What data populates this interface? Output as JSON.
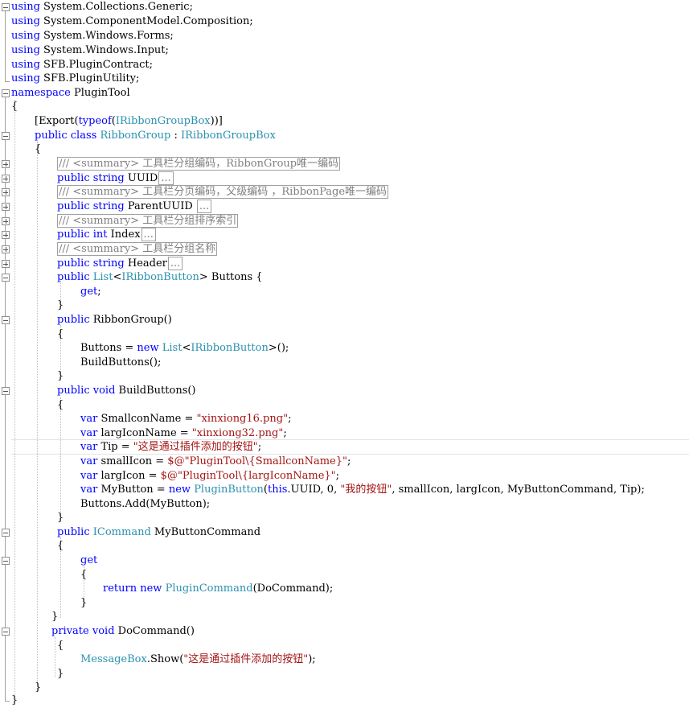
{
  "code": {
    "using1": "using",
    "ns1": "System.Collections.Generic;",
    "using2": "using",
    "ns2": "System.ComponentModel.Composition;",
    "using3": "using",
    "ns3": "System.Windows.Forms;",
    "using4": "using",
    "ns4": "System.Windows.Input;",
    "using5": "using",
    "ns5": "SFB.PluginContract;",
    "using6": "using",
    "ns6": "SFB.PluginUtility;",
    "namespace_kw": "namespace",
    "namespace_name": "PluginTool",
    "brace_open": "{",
    "brace_close": "}",
    "export_open": "[Export(",
    "typeof_kw": "typeof",
    "paren_open": "(",
    "iface": "IRibbonGroupBox",
    "export_close": "))]",
    "public_kw": "public",
    "class_kw": "class",
    "class_name": "RibbonGroup",
    "colon": " : ",
    "comment_uuid": "/// <summary> 工具栏分组编码，RibbonGroup唯一编码",
    "string_kw": "string",
    "prop_uuid": "UUID",
    "ellipsis": "...",
    "comment_parent": "/// <summary> 工具栏分页编码，父级编码 ，RibbonPage唯一编码",
    "prop_parent": "ParentUUID ",
    "comment_index": "/// <summary> 工具栏分组排序索引",
    "int_kw": "int",
    "prop_index": "Index",
    "comment_header": "/// <summary> 工具栏分组名称",
    "prop_header": "Header",
    "list_type": "List",
    "lt": "<",
    "button_iface": "IRibbonButton",
    "gt": ">",
    "prop_buttons": " Buttons {",
    "get_kw": "get",
    "semicolon": ";",
    "ctor": " RibbonGroup()",
    "buttons_assign": "Buttons = ",
    "new_kw": "new",
    "list_ctor_end": "();",
    "build_call": "BuildButtons();",
    "void_kw": "void",
    "build_method": " BuildButtons()",
    "var_kw": "var",
    "small_name_decl": " SmallconName = ",
    "small_name_val": "\"xinxiong16.png\"",
    "larg_name_decl": " largIconName = ",
    "larg_name_val": "\"xinxiong32.png\"",
    "tip_decl": " Tip = ",
    "tip_val": "\"这是通过插件添加的按钮\"",
    "small_icon_decl": " smallIcon = ",
    "small_icon_val": "$@\"PluginTool\\{SmallconName}\"",
    "larg_icon_decl": " largIcon = ",
    "larg_icon_val": "$@\"PluginTool\\{largIconName}\"",
    "mybutton_decl": " MyButton = ",
    "plugin_button": "PluginButton",
    "this_kw": "this",
    "mybutton_args1": ".UUID, 0, ",
    "mybutton_str": "\"我的按钮\"",
    "mybutton_args2": ", smallIcon, largIcon, MyButtonCommand, Tip);",
    "buttons_add": "Buttons.Add(MyButton);",
    "icommand": "ICommand",
    "mybutton_command": " MyButtonCommand",
    "return_kw": "return",
    "plugin_command": "PluginCommand",
    "do_command_arg": "(DoCommand);",
    "private_kw": "private",
    "do_command": " DoCommand()",
    "messagebox": "MessageBox",
    "show_open": ".Show(",
    "show_str": "\"这是通过插件添加的按钮\"",
    "show_close": ");"
  }
}
